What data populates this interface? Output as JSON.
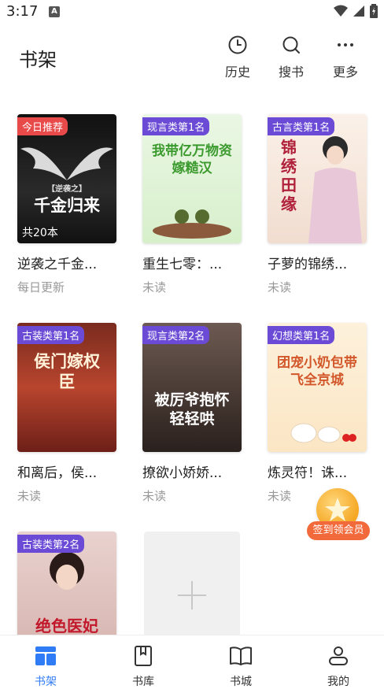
{
  "status_bar": {
    "time": "3:17",
    "app_icon_letter": "A"
  },
  "header": {
    "title": "书架",
    "actions": [
      {
        "label": "历史",
        "icon": "clock-icon"
      },
      {
        "label": "搜书",
        "icon": "search-icon"
      },
      {
        "label": "更多",
        "icon": "more-icon"
      }
    ]
  },
  "books": [
    {
      "badge": "今日推荐",
      "badge_color": "#e84a4a",
      "cover_text": "千金归来",
      "cover_sub": "【逆袭之】",
      "count_label": "共20本",
      "name": "逆袭之千金...",
      "status": "每日更新"
    },
    {
      "badge": "现言类第1名",
      "badge_color": "#6b4bd6",
      "cover_text": "我带亿万物资嫁糙汉",
      "name": "重生七零：...",
      "status": "未读"
    },
    {
      "badge": "古言类第1名",
      "badge_color": "#6b4bd6",
      "cover_text": "锦绣田缘",
      "name": "子萝的锦绣...",
      "status": "未读"
    },
    {
      "badge": "古装类第1名",
      "badge_color": "#6b4bd6",
      "cover_text": "侯门嫁权臣",
      "name": "和离后，侯...",
      "status": "未读"
    },
    {
      "badge": "现言类第2名",
      "badge_color": "#6b4bd6",
      "cover_text": "被厉爷抱怀轻轻哄",
      "name": "撩欲小娇娇...",
      "status": "未读"
    },
    {
      "badge": "幻想类第1名",
      "badge_color": "#6b4bd6",
      "cover_text": "团宠小奶包带飞全京城",
      "name": "炼灵符！诛...",
      "status": "未读"
    },
    {
      "badge": "古装类第2名",
      "badge_color": "#6b4bd6",
      "cover_text": "绝色医妃"
    }
  ],
  "float_sign": {
    "label": "签到领会员"
  },
  "bottom_nav": [
    {
      "label": "书架",
      "icon": "bookshelf-icon",
      "active": true
    },
    {
      "label": "书库",
      "icon": "library-icon",
      "active": false
    },
    {
      "label": "书城",
      "icon": "bookstore-icon",
      "active": false
    },
    {
      "label": "我的",
      "icon": "profile-icon",
      "active": false
    }
  ],
  "colors": {
    "accent": "#2f7cf6",
    "badge_red": "#e84a4a",
    "badge_purple": "#6b4bd6",
    "sign_orange": "#f26a3b"
  }
}
